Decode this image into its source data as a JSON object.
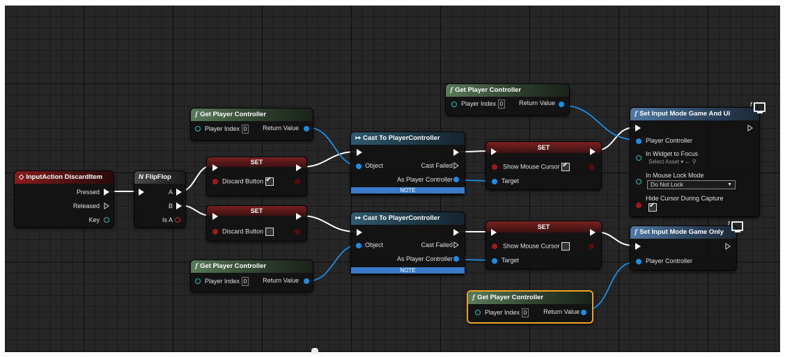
{
  "nodes": {
    "input_action": {
      "title": "InputAction DiscardItem",
      "pins": [
        "Pressed",
        "Released",
        "Key"
      ]
    },
    "flipflop": {
      "title": "FlipFlop",
      "pins": [
        "A",
        "B",
        "Is A"
      ]
    },
    "get_pc_1": {
      "title": "Get Player Controller",
      "pin_in": "Player Index",
      "pin_in_value": "0",
      "pin_out": "Return Value"
    },
    "get_pc_2": {
      "title": "Get Player Controller",
      "pin_in": "Player Index",
      "pin_in_value": "0",
      "pin_out": "Return Value"
    },
    "get_pc_3": {
      "title": "Get Player Controller",
      "pin_in": "Player Index",
      "pin_in_value": "0",
      "pin_out": "Return Value"
    },
    "get_pc_4": {
      "title": "Get Player Controller",
      "pin_in": "Player Index",
      "pin_in_value": "0",
      "pin_out": "Return Value"
    },
    "set_discard_1": {
      "title": "SET",
      "label": "Discard Button",
      "checked": true
    },
    "set_discard_2": {
      "title": "SET",
      "label": "Discard Button",
      "checked": false
    },
    "cast_1": {
      "title": "Cast To PlayerController",
      "object": "Object",
      "cast_failed": "Cast Failed",
      "as_pc": "As Player Controller",
      "note": "NOTE"
    },
    "cast_2": {
      "title": "Cast To PlayerController",
      "object": "Object",
      "cast_failed": "Cast Failed",
      "as_pc": "As Player Controller",
      "note": "NOTE"
    },
    "set_mouse_1": {
      "title": "SET",
      "label": "Show Mouse Cursor",
      "target": "Target",
      "checked": true
    },
    "set_mouse_2": {
      "title": "SET",
      "label": "Show Mouse Cursor",
      "target": "Target",
      "checked": false
    },
    "input_game_ui": {
      "title": "Set Input Mode Game And UI",
      "player_controller": "Player Controller",
      "widget_label": "In Widget to Focus",
      "widget_value": "Select Asset",
      "lock_label": "In Mouse Lock Mode",
      "lock_value": "Do Not Lock",
      "hide_label": "Hide Cursor During Capture",
      "hide_checked": true
    },
    "input_game_only": {
      "title": "Set Input Mode Game Only",
      "player_controller": "Player Controller"
    }
  },
  "colors": {
    "exec_wire": "#ffffff",
    "object_wire": "#1a8ee8",
    "selection": "#f0a41e",
    "note": "#3c7ac9"
  },
  "icons": {
    "function": "function-f-icon",
    "event": "event-diamond-icon",
    "flipflop": "flipflop-icon",
    "cast": "cast-arrows-icon",
    "remote": "monitor-icon",
    "cursor": "hand-cursor-icon"
  }
}
